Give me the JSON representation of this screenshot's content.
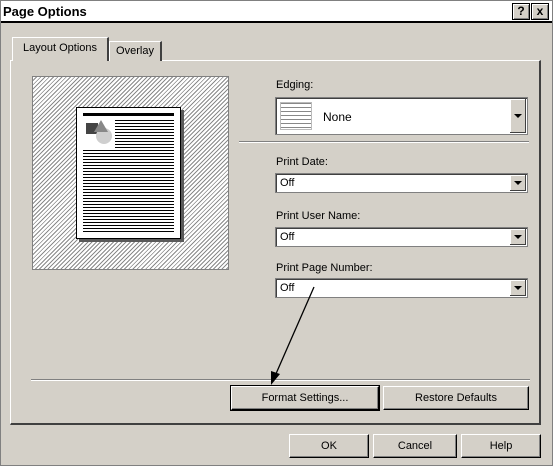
{
  "window": {
    "title": "Page Options",
    "help_button": "?",
    "close_button": "x"
  },
  "tabs": [
    {
      "label": "Layout Options",
      "active": true
    },
    {
      "label": "Overlay",
      "active": false
    }
  ],
  "edging": {
    "label": "Edging:",
    "value": "None"
  },
  "print_date": {
    "label": "Print Date:",
    "value": "Off"
  },
  "print_user_name": {
    "label": "Print User Name:",
    "value": "Off"
  },
  "print_page_number": {
    "label": "Print Page Number:",
    "value": "Off"
  },
  "actions": {
    "format_settings": "Format Settings...",
    "restore_defaults": "Restore Defaults"
  },
  "dialog_buttons": {
    "ok": "OK",
    "cancel": "Cancel",
    "help": "Help"
  },
  "icons": {
    "help": "question-mark-icon",
    "close": "close-icon",
    "dropdown": "chevron-down-icon",
    "preview": "page-preview-icon",
    "edging": "edging-swatch-icon",
    "callout": "callout-arrow-icon"
  },
  "colors": {
    "dialog_face": "#d4d0c8",
    "shadow": "#808080",
    "highlight": "#ffffff"
  }
}
